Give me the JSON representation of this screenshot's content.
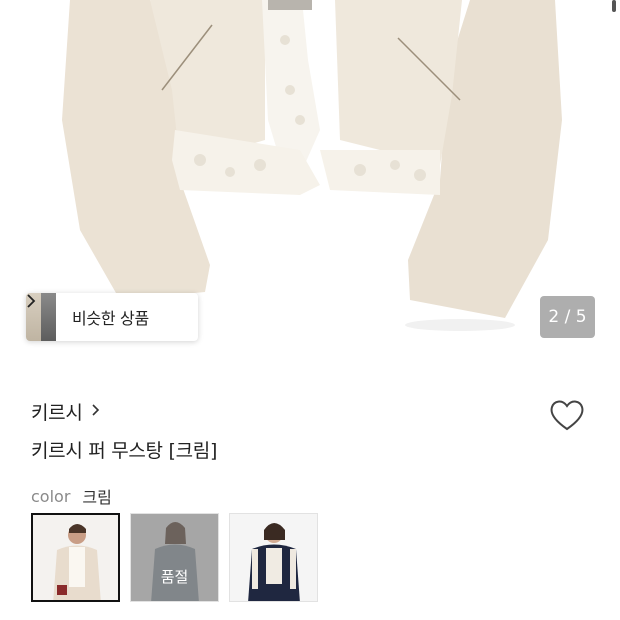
{
  "gallery": {
    "image_alt_icon": "cream-fur-mustang-jacket",
    "page_current": "2",
    "page_total": "5",
    "page_counter": "2 / 5",
    "similar_products_label": "비슷한 상품",
    "similar_products_chevron": "›"
  },
  "product": {
    "brand": "키르시",
    "brand_chevron": "›",
    "title": "키르시 퍼 무스탕 [크림]",
    "wishlist_icon": "heart-outline-icon",
    "color_key": "color",
    "color_value": "크림",
    "swatches": [
      {
        "name": "swatch-cream",
        "selected": true,
        "sold_out": false,
        "sold_out_label": ""
      },
      {
        "name": "swatch-grey",
        "selected": false,
        "sold_out": true,
        "sold_out_label": "품절"
      },
      {
        "name": "swatch-navy",
        "selected": false,
        "sold_out": false,
        "sold_out_label": ""
      }
    ]
  },
  "colors": {
    "jacket": "#ece4d8",
    "fur": "#f6f3ec",
    "text": "#222222",
    "muted": "#8a8a8a"
  }
}
